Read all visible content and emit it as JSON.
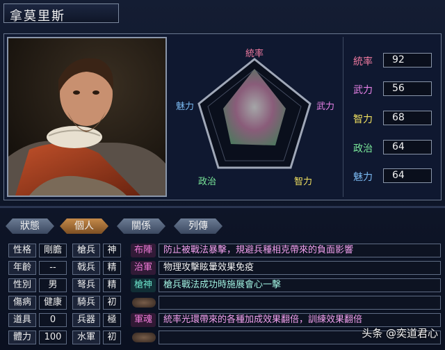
{
  "character": {
    "name": "拿莫里斯"
  },
  "radar": {
    "labels": {
      "lead": "統率",
      "war": "武力",
      "intel": "智力",
      "pol": "政治",
      "charm": "魅力"
    }
  },
  "stats": [
    {
      "label": "統率",
      "value": "92",
      "color": "#f07aa0"
    },
    {
      "label": "武力",
      "value": "56",
      "color": "#e882e8"
    },
    {
      "label": "智力",
      "value": "68",
      "color": "#f0e060"
    },
    {
      "label": "政治",
      "value": "64",
      "color": "#7ae89a"
    },
    {
      "label": "魅力",
      "value": "64",
      "color": "#7ab8f0"
    }
  ],
  "tabs": [
    "狀態",
    "個人",
    "關係",
    "列傳"
  ],
  "active_tab": "個人",
  "profile": [
    {
      "label": "性格",
      "value": "剛膽"
    },
    {
      "label": "年齡",
      "value": "--"
    },
    {
      "label": "性別",
      "value": "男"
    },
    {
      "label": "傷病",
      "value": "健康"
    },
    {
      "label": "道具",
      "value": "0"
    },
    {
      "label": "體力",
      "value": "100"
    }
  ],
  "troops": [
    {
      "label": "槍兵",
      "value": "神"
    },
    {
      "label": "戟兵",
      "value": "精"
    },
    {
      "label": "弩兵",
      "value": "精"
    },
    {
      "label": "騎兵",
      "value": "初"
    },
    {
      "label": "兵器",
      "value": "極"
    },
    {
      "label": "水軍",
      "value": "初"
    }
  ],
  "skills": [
    {
      "name": "布陣",
      "color": "#f07ad8",
      "desc": "防止被戰法暴擊，規避兵種相克帶來的負面影響",
      "desc_color": "#f2a0ee"
    },
    {
      "name": "治軍",
      "color": "#f07ad8",
      "desc": "物理攻擊眩暈效果免疫",
      "desc_color": "#f0f0f0"
    },
    {
      "name": "槍神",
      "color": "#6ae0c8",
      "desc": "槍兵戰法成功時施展會心一擊",
      "desc_color": "#a0f0e0"
    },
    {
      "name": "",
      "color": "#f0f0f0",
      "desc": "",
      "desc_color": "#f0f0f0"
    },
    {
      "name": "軍魂",
      "color": "#f07ad8",
      "desc": "統率光環帶來的各種加成效果翻倍，訓練效果翻倍",
      "desc_color": "#f2a0ee"
    },
    {
      "name": "",
      "color": "#f0f0f0",
      "desc": "",
      "desc_color": "#f0f0f0"
    }
  ],
  "watermark": "头条 @奕道君心"
}
